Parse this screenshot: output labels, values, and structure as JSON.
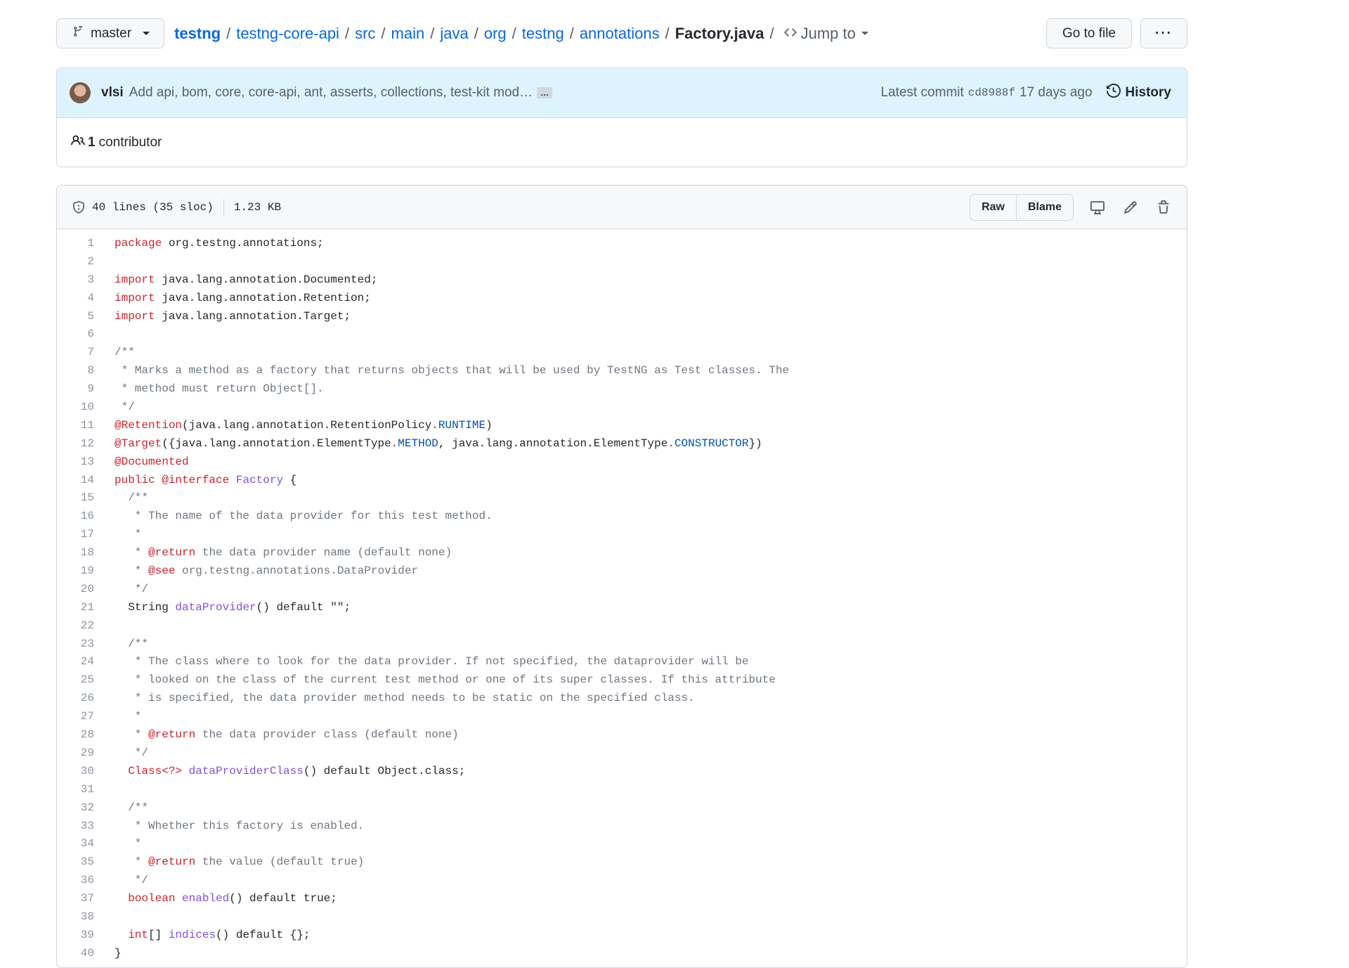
{
  "branch": {
    "name": "master"
  },
  "breadcrumb": {
    "root": "testng",
    "segments": [
      "testng-core-api",
      "src",
      "main",
      "java",
      "org",
      "testng",
      "annotations"
    ],
    "file": "Factory.java",
    "separator": "/",
    "jump_label": "Jump to"
  },
  "actions": {
    "go_to_file": "Go to file",
    "more": "···"
  },
  "commit": {
    "author": "vlsi",
    "message": "Add api, bom, core, core-api, ant, asserts, collections, test-kit mod…",
    "ellipsis": "…",
    "latest_label": "Latest commit",
    "sha": "cd8988f",
    "age": "17 days ago",
    "history_label": "History"
  },
  "contributors": {
    "count": "1",
    "label": "contributor"
  },
  "file_info": {
    "lines": "40 lines (35 sloc)",
    "size": "1.23 KB"
  },
  "file_actions": {
    "raw": "Raw",
    "blame": "Blame"
  },
  "icons": {
    "branch": "git-branch-icon",
    "code": "code-icon",
    "history": "history-icon",
    "people": "people-icon",
    "shield": "shield-icon",
    "desktop": "desktop-icon",
    "pencil": "pencil-icon",
    "trash": "trash-icon"
  },
  "colors": {
    "link": "#0969da",
    "keyword": "#cf222e",
    "comment": "#6e7781",
    "entity": "#8250df",
    "constant": "#0550ae",
    "commit_bg": "#ddf4ff"
  },
  "code_lines": [
    "package org.testng.annotations;",
    "",
    "import java.lang.annotation.Documented;",
    "import java.lang.annotation.Retention;",
    "import java.lang.annotation.Target;",
    "",
    "/**",
    " * Marks a method as a factory that returns objects that will be used by TestNG as Test classes. The",
    " * method must return Object[].",
    " */",
    "@Retention(java.lang.annotation.RetentionPolicy.RUNTIME)",
    "@Target({java.lang.annotation.ElementType.METHOD, java.lang.annotation.ElementType.CONSTRUCTOR})",
    "@Documented",
    "public @interface Factory {",
    "  /**",
    "   * The name of the data provider for this test method.",
    "   *",
    "   * @return the data provider name (default none)",
    "   * @see org.testng.annotations.DataProvider",
    "   */",
    "  String dataProvider() default \"\";",
    "",
    "  /**",
    "   * The class where to look for the data provider. If not specified, the dataprovider will be",
    "   * looked on the class of the current test method or one of its super classes. If this attribute",
    "   * is specified, the data provider method needs to be static on the specified class.",
    "   *",
    "   * @return the data provider class (default none)",
    "   */",
    "  Class<?> dataProviderClass() default Object.class;",
    "",
    "  /**",
    "   * Whether this factory is enabled.",
    "   *",
    "   * @return the value (default true)",
    "   */",
    "  boolean enabled() default true;",
    "",
    "  int[] indices() default {};",
    "}"
  ]
}
